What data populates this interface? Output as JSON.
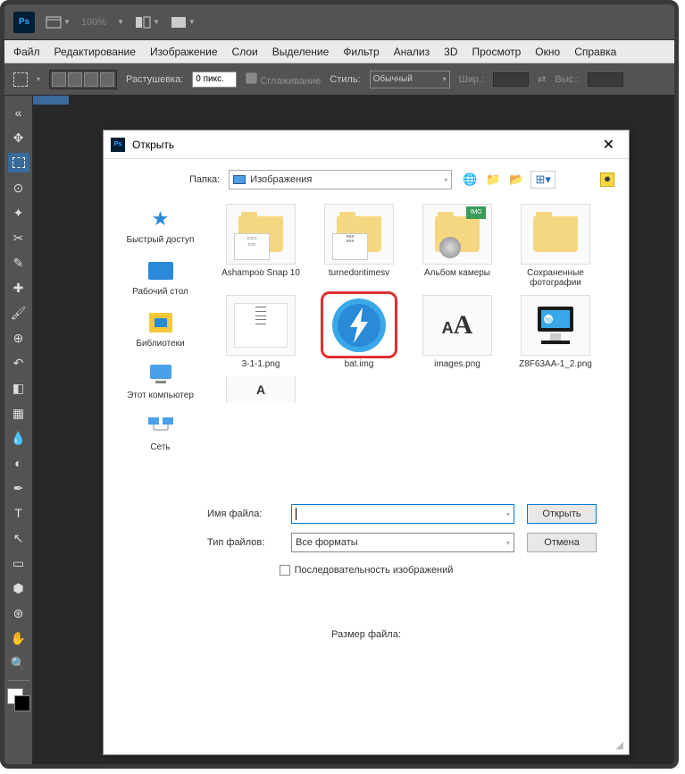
{
  "menubar": {
    "items": [
      "Файл",
      "Редактирование",
      "Изображение",
      "Слои",
      "Выделение",
      "Фильтр",
      "Анализ",
      "3D",
      "Просмотр",
      "Окно",
      "Справка"
    ]
  },
  "toolbar": {
    "zoom": "100%"
  },
  "options": {
    "feather_label": "Растушевка:",
    "feather_value": "0 пикс.",
    "anti_alias": "Сглаживание",
    "style_label": "Стиль:",
    "style_value": "Обычный",
    "width_label": "Шир.:",
    "height_label": "Выс.:"
  },
  "dialog": {
    "title": "Открыть",
    "folder_label": "Папка:",
    "folder_value": "Изображения",
    "places": [
      {
        "label": "Быстрый доступ",
        "icon": "star"
      },
      {
        "label": "Рабочий стол",
        "icon": "desktop"
      },
      {
        "label": "Библиотеки",
        "icon": "libraries"
      },
      {
        "label": "Этот компьютер",
        "icon": "computer"
      },
      {
        "label": "Сеть",
        "icon": "network"
      }
    ],
    "files": [
      {
        "name": "Ashampoo Snap 10",
        "type": "folder-preview"
      },
      {
        "name": "turnedontimesv",
        "type": "folder-preview"
      },
      {
        "name": "Альбом камеры",
        "type": "folder-img"
      },
      {
        "name": "Сохраненные фотографии",
        "type": "folder"
      },
      {
        "name": "3-1-1.png",
        "type": "image-doc"
      },
      {
        "name": "bat.img",
        "type": "daemon",
        "highlight": true
      },
      {
        "name": "images.png",
        "type": "aa"
      },
      {
        "name": "Z8F63AA-1_2.png",
        "type": "monitor"
      }
    ],
    "filename_label": "Имя файла:",
    "filename_value": "",
    "filetype_label": "Тип файлов:",
    "filetype_value": "Все форматы",
    "open_btn": "Открыть",
    "cancel_btn": "Отмена",
    "sequence_label": "Последовательность изображений",
    "filesize_label": "Размер файла:"
  }
}
